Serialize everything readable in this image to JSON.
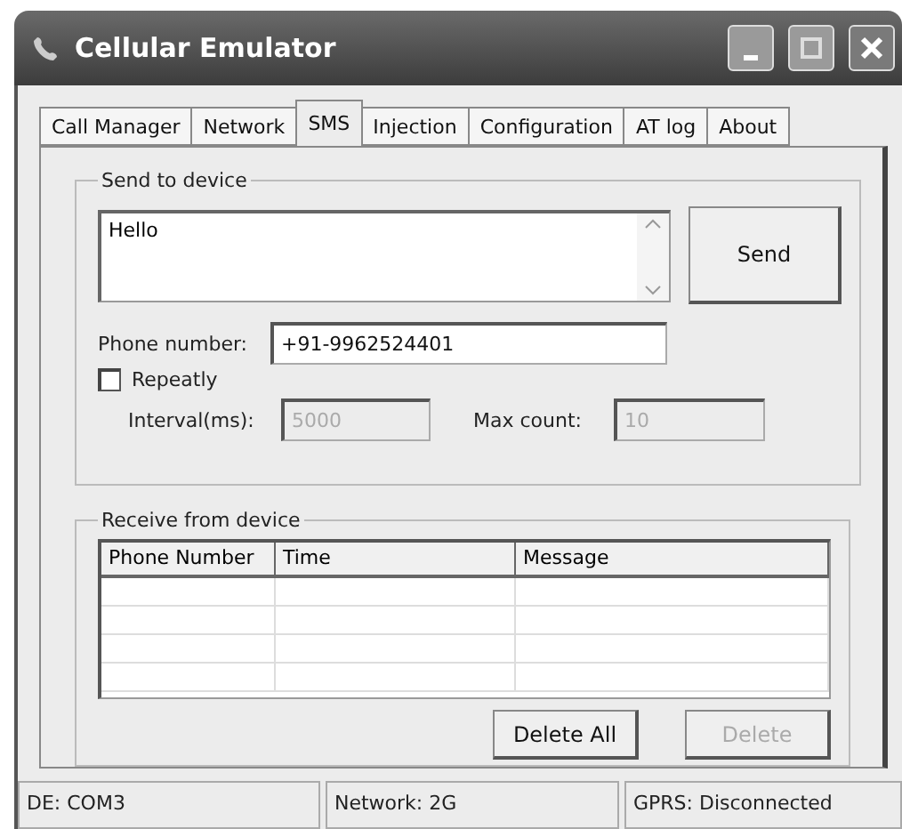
{
  "window": {
    "title": "Cellular Emulator"
  },
  "tabs": [
    {
      "label": "Call Manager",
      "selected": false
    },
    {
      "label": "Network",
      "selected": false
    },
    {
      "label": "SMS",
      "selected": true
    },
    {
      "label": "Injection",
      "selected": false
    },
    {
      "label": "Configuration",
      "selected": false
    },
    {
      "label": "AT log",
      "selected": false
    },
    {
      "label": "About",
      "selected": false
    }
  ],
  "send_group": {
    "title": "Send to device",
    "message": "Hello",
    "send_button": "Send",
    "phone_label": "Phone number:",
    "phone_value": "+91-9962524401",
    "repeat": {
      "label": "Repeatly",
      "checked": false
    },
    "interval": {
      "label": "Interval(ms):",
      "value": "5000",
      "disabled": true
    },
    "max_count": {
      "label": "Max count:",
      "value": "10",
      "disabled": true
    }
  },
  "receive_group": {
    "title": "Receive from device",
    "table": {
      "columns": [
        "Phone Number",
        "Time",
        "Message"
      ]
    },
    "buttons": [
      {
        "label": "Delete All",
        "disabled": false
      },
      {
        "label": "Delete",
        "disabled": true
      }
    ]
  },
  "status_bar": [
    "DE: COM3",
    "Network: 2G",
    "GPRS: Disconnected"
  ]
}
